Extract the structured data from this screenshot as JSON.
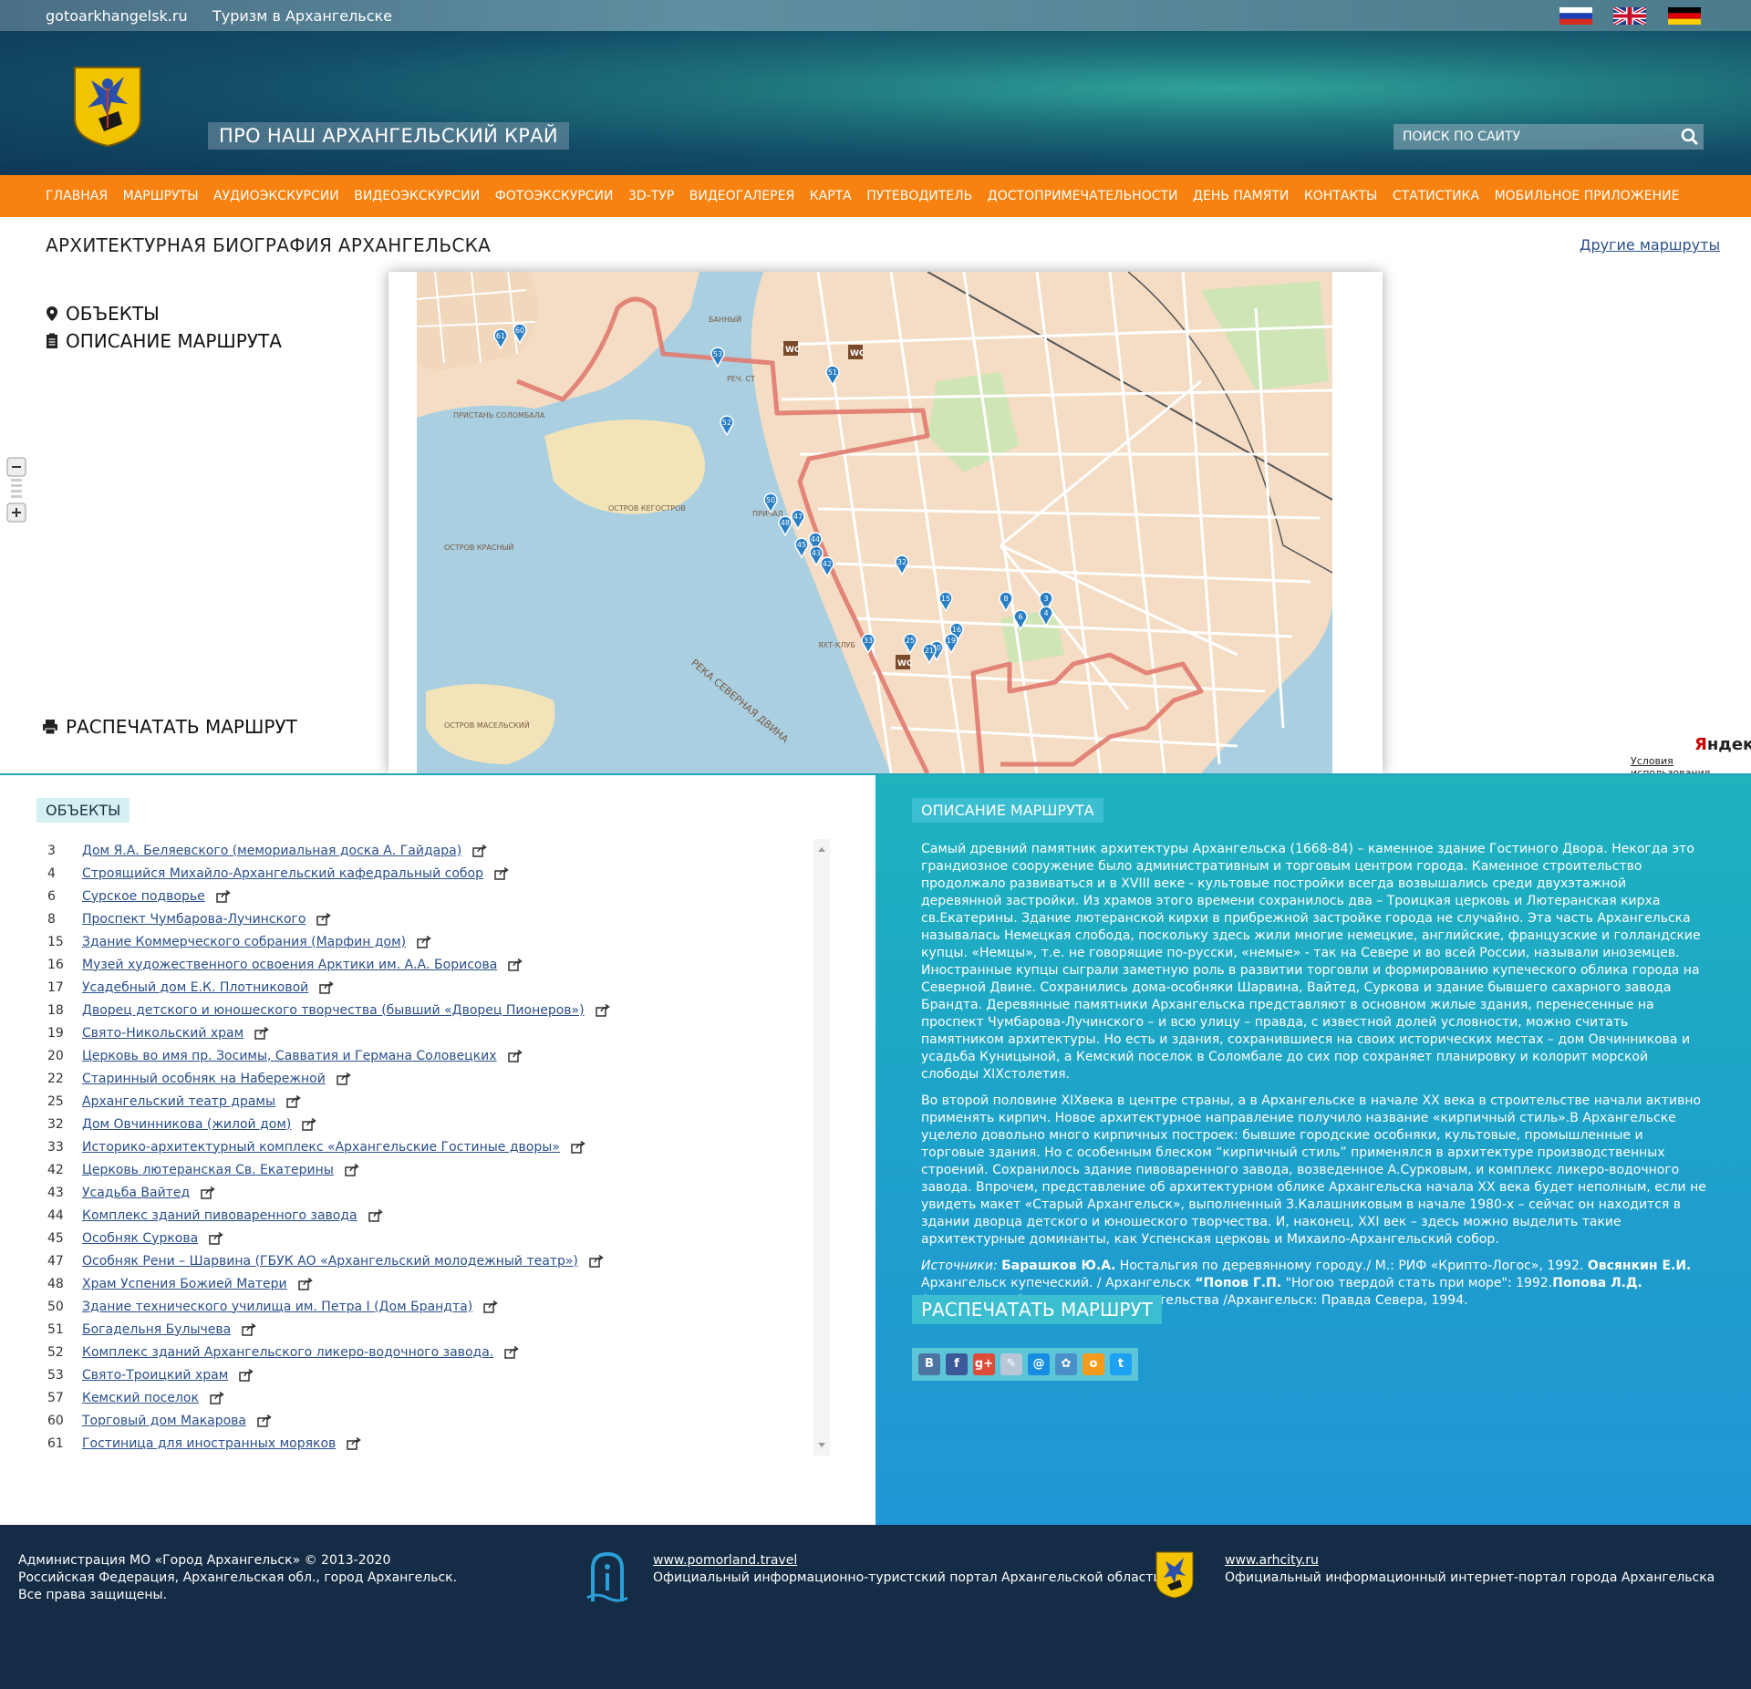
{
  "topbar": {
    "site": "gotoarkhangelsk.ru",
    "tourism": "Туризм в Архангельске"
  },
  "header": {
    "slogan": "ПРО НАШ АРХАНГЕЛЬСКИЙ КРАЙ",
    "search_placeholder": "ПОИСК ПО САЙТУ"
  },
  "nav": [
    "ГЛАВНАЯ",
    "МАРШРУТЫ",
    "АУДИОЭКСКУРСИИ",
    "ВИДЕОЭКСКУРСИИ",
    "ФОТОЭКСКУРСИИ",
    "3D-ТУР",
    "ВИДЕОГАЛЕРЕЯ",
    "КАРТА",
    "ПУТЕВОДИТЕЛЬ",
    "ДОСТОПРИМЕЧАТЕЛЬНОСТИ",
    "ДЕНЬ ПАМЯТИ",
    "КОНТАКТЫ",
    "СТАТИСТИКА",
    "МОБИЛЬНОЕ ПРИЛОЖЕНИЕ"
  ],
  "route": {
    "title": "АРХИТЕКТУРНАЯ БИОГРАФИЯ АРХАНГЕЛЬСКА",
    "other_routes": "Другие маршруты",
    "objects_link": "ОБЪЕКТЫ",
    "description_link": "ОПИСАНИЕ МАРШРУТА",
    "print_link": "РАСПЕЧАТАТЬ МАРШРУТ"
  },
  "map": {
    "labels": [
      "ПРИСТАНЬ СОЛОМБАЛА",
      "ОСТРОВ КЕГОСТРОВ",
      "РЕКА СЕВЕРНАЯ ДВИНА",
      "ОСТРОВ МАСЕЛЬСКИЙ",
      "ОСТРОВ КРАСНЫЙ",
      "ПРИЧАЛ",
      "ЯХТ-КЛУБ",
      "РЕЧ. СТ",
      "БАННЫЙ"
    ],
    "markers": [
      "61",
      "60",
      "53",
      "51",
      "52",
      "50",
      "48",
      "47",
      "44",
      "45",
      "43",
      "42",
      "32",
      "33",
      "25",
      "15",
      "8",
      "3",
      "6",
      "4",
      "16",
      "19",
      "20",
      "21"
    ],
    "wc": "WC",
    "attribution_brand_a": "Я",
    "attribution_brand_b": "ндекс",
    "terms": "Условия использования"
  },
  "objects": {
    "title": "ОБЪЕКТЫ",
    "items": [
      {
        "num": "3",
        "name": "Дом Я.А. Беляевского (мемориальная доска А. Гайдара)"
      },
      {
        "num": "4",
        "name": "Строящийся Михайло-Архангельский кафедральный собор"
      },
      {
        "num": "6",
        "name": "Сурское подворье"
      },
      {
        "num": "8",
        "name": "Проспект Чумбарова-Лучинского"
      },
      {
        "num": "15",
        "name": "Здание Коммерческого собрания (Марфин дом)"
      },
      {
        "num": "16",
        "name": "Музей художественного освоения Арктики им. А.А. Борисова"
      },
      {
        "num": "17",
        "name": "Усадебный дом Е.К. Плотниковой"
      },
      {
        "num": "18",
        "name": "Дворец детского и юношеского творчества (бывший «Дворец Пионеров»)"
      },
      {
        "num": "19",
        "name": "Свято-Никольский храм"
      },
      {
        "num": "20",
        "name": "Церковь во имя пр. Зосимы, Савватия и Германа Соловецких"
      },
      {
        "num": "22",
        "name": "Старинный особняк на Набережной"
      },
      {
        "num": "25",
        "name": "Архангельский театр драмы"
      },
      {
        "num": "32",
        "name": "Дом Овчинникова (жилой дом)"
      },
      {
        "num": "33",
        "name": "Историко-архитектурный комплекс «Архангельские Гостиные дворы»"
      },
      {
        "num": "42",
        "name": "Церковь лютеранская Св. Екатерины"
      },
      {
        "num": "43",
        "name": "Усадьба Вайтед"
      },
      {
        "num": "44",
        "name": "Комплекс зданий пивоваренного завода"
      },
      {
        "num": "45",
        "name": "Особняк Суркова"
      },
      {
        "num": "47",
        "name": "Особняк Рени – Шарвина (ГБУК АО «Архангельский молодежный театр»)"
      },
      {
        "num": "48",
        "name": "Храм Успения Божией Матери"
      },
      {
        "num": "50",
        "name": "Здание технического училища им. Петра I (Дом Брандта)"
      },
      {
        "num": "51",
        "name": "Богадельня Булычева"
      },
      {
        "num": "52",
        "name": "Комплекс зданий Архангельского ликеро-водочного завода."
      },
      {
        "num": "53",
        "name": "Свято-Троицкий храм"
      },
      {
        "num": "57",
        "name": "Кемский поселок"
      },
      {
        "num": "60",
        "name": "Торговый дом Макарова"
      },
      {
        "num": "61",
        "name": "Гостиница для иностранных моряков"
      }
    ]
  },
  "description": {
    "title": "ОПИСАНИЕ МАРШРУТА",
    "p1": "Самый древний памятник архитектуры Архангельска (1668-84) – каменное здание Гостиного Двора. Некогда это грандиозное сооружение было административным и торговым центром города. Каменное строительство продолжало развиваться и в XVIII веке  - культовые постройки всегда возвышались среди двухэтажной деревянной застройки. Из храмов этого времени сохранилось два – Троицкая церковь и Лютеранская кирха св.Екатерины. Здание лютеранской кирхи в прибрежной застройке города не случайно. Эта часть Архангельска называлась Немецкая слобода, поскольку здесь жили многие немецкие, английские, французские и голландские купцы. «Немцы», т.е. не говорящие по-русски, «немые»  - так на Севере и во всей России, называли иноземцев. Иностранные купцы сыграли заметную роль в развитии торговли и  формированию купеческого облика города на Северной Двине. Сохранились дома-особняки Шарвина, Вайтед, Суркова и здание бывшего сахарного завода Брандта. Деревянные памятники Архангельска представляют в основном жилые здания, перенесенные на проспект Чумбарова-Лучинского  – и всю улицу – правда, с известной долей условности, можно считать памятником архитектуры. Но есть и здания, сохранившиеся на своих исторических местах – дом Овчинникова и усадьба Куницыной, а Кемский поселок в Соломбале до сих пор сохраняет планировку и колорит морской слободы XIXстолетия.",
    "p2": "Во второй половине  XIXвека в центре страны, а в Архангельске в начале XX века в строительстве начали активно применять кирпич. Новое архитектурное направление получило название «кирпичный стиль».В Архангельске уцелело довольно много кирпичных построек: бывшие городские особняки, культовые, промышленные и торговые  здания. Но с особенным блеском “кирпичный стиль” применялся в архитектуре производственных строений. Сохранилось здание пивоваренного завода, возведенное А.Сурковым, и комплекс ликеро-водочного завода. Впрочем, представление об архитектурном облике Архангельска начала XX века будет неполным, если не увидеть макет «Старый Архангельск», выполненный З.Калашниковым в начале 1980-х – сейчас он находится в здании дворца детского и юношеского творчества. И, наконец, XXI век – здесь можно выделить такие архитектурные доминанты, как Успенская церковь и Михаило-Архангельский собор.",
    "src_label": "Источники:",
    "src_a1": "Барашков Ю.А.",
    "src_t1": " Ностальгия по деревянному городу./ М.: РИФ «Крипто-Логос», 1992. ",
    "src_a2": "Овсянкин Е.И.",
    "src_t2": " Архангельск купеческий. / Архангельск ",
    "src_a3": "“Попов Г.П.",
    "src_t3": " \"Ногою твердой стать при море\": 1992.",
    "src_a4": "Попова Л.Д.",
    "src_t4": "  Архангельск: Очерк истории строительства /Архангельск: Правда Севера, 1994.",
    "print": "РАСПЕЧАТАТЬ МАРШРУТ",
    "social": [
      "В",
      "f",
      "g+",
      "✎",
      "@",
      "✿",
      "о",
      "t"
    ]
  },
  "footer": {
    "l1": "Администрация МО «Город Архангельск»   © 2013-2020",
    "l2": "Российская Федерация, Архангельская обл., город Архангельск.",
    "l3": "Все права защищены.",
    "m_link": "www.pomorland.travel",
    "m_text": "Официальный информационно-туристский портал Архангельской области",
    "r_link": "www.arhcity.ru",
    "r_text": "Официальный информационный интернет-портал города Архангельска"
  },
  "colors": {
    "nav": "#f7820f",
    "link": "#2a4f8a",
    "route": "#e07a70",
    "marker": "#2a7fc4",
    "footer": "#142c45",
    "panel": "#1eb3bd"
  }
}
